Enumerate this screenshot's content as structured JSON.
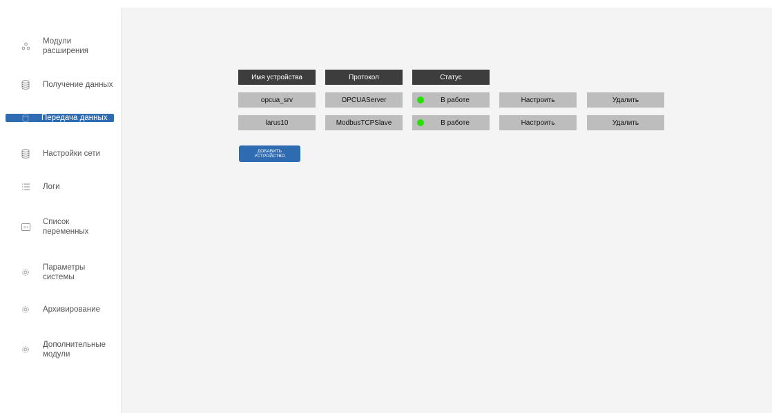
{
  "sidebar": {
    "items": [
      {
        "label_line1": "Модули",
        "label_line2": "расширения",
        "icon": "modules-icon",
        "active": false
      },
      {
        "label_line1": "Получение данных",
        "label_line2": "",
        "icon": "database-icon",
        "active": false
      },
      {
        "label_line1": "Передача данных",
        "label_line2": "",
        "icon": "database-icon",
        "active": true
      },
      {
        "label_line1": "Настройки сети",
        "label_line2": "",
        "icon": "database-icon",
        "active": false
      },
      {
        "label_line1": "Логи",
        "label_line2": "",
        "icon": "list-icon",
        "active": false
      },
      {
        "label_line1": "Список",
        "label_line2": "переменных",
        "icon": "variables-icon",
        "active": false
      },
      {
        "label_line1": "Параметры",
        "label_line2": "системы",
        "icon": "gear-icon",
        "active": false
      },
      {
        "label_line1": "Архивирование",
        "label_line2": "",
        "icon": "gear-icon",
        "active": false
      },
      {
        "label_line1": "Дополнительные",
        "label_line2": "модули",
        "icon": "gear-icon",
        "active": false
      }
    ]
  },
  "table": {
    "headers": [
      "Имя устройства",
      "Протокол",
      "Статус"
    ],
    "rows": [
      {
        "name": "opcua_srv",
        "protocol": "OPCUAServer",
        "status": "В работе",
        "status_color": "#26e000"
      },
      {
        "name": "larus10",
        "protocol": "ModbusTCPSlave",
        "status": "В работе",
        "status_color": "#26e000"
      }
    ],
    "configure_label": "Настроить",
    "delete_label": "Удалить"
  },
  "add_button": {
    "line1": "Добавить",
    "line2": "устройство"
  },
  "colors": {
    "accent": "#2f6bb0",
    "header_bg": "#3d3d3d",
    "cell_bg": "#bdbdbd",
    "status_ok": "#26e000",
    "content_bg": "#f4f4f4"
  }
}
